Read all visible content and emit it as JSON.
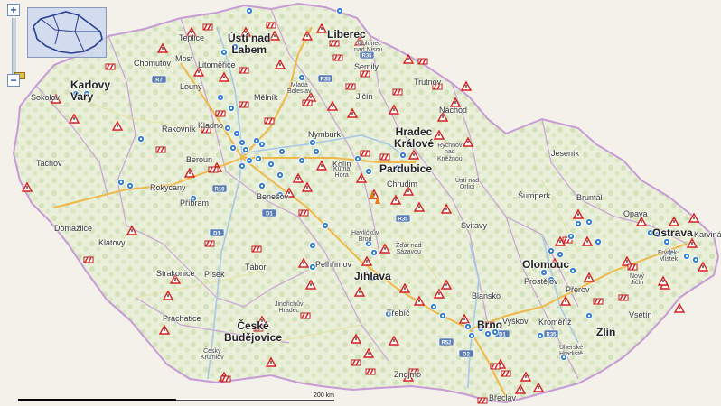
{
  "map": {
    "cities_big": [
      {
        "id": "karlovy-vary",
        "text": "Karlovy\nVary"
      },
      {
        "id": "usti",
        "text": "Ústí nad\nLabem"
      },
      {
        "id": "liberec",
        "text": "Liberec"
      },
      {
        "id": "hradec",
        "text": "Hradec\nKrálové"
      },
      {
        "id": "pardubice",
        "text": "Pardubice"
      },
      {
        "id": "jihlava",
        "text": "Jihlava"
      },
      {
        "id": "olomouc",
        "text": "Olomouc"
      },
      {
        "id": "ostrava",
        "text": "Ostrava"
      },
      {
        "id": "ceske",
        "text": "České\nBudějovice"
      },
      {
        "id": "brno",
        "text": "Brno"
      },
      {
        "id": "zlin",
        "text": "Zlín"
      }
    ],
    "cities_small": [
      {
        "id": "teplice",
        "text": "Teplice"
      },
      {
        "id": "chomutov",
        "text": "Chomutov"
      },
      {
        "id": "most",
        "text": "Most"
      },
      {
        "id": "litomerice",
        "text": "Litoměřice"
      },
      {
        "id": "jablonec",
        "text": "Jablonec\nnad Nisou"
      },
      {
        "id": "semily",
        "text": "Semily"
      },
      {
        "id": "trutnov",
        "text": "Trutnov"
      },
      {
        "id": "nachod",
        "text": "Náchod"
      },
      {
        "id": "sokolov",
        "text": "Sokolov"
      },
      {
        "id": "louny",
        "text": "Louny"
      },
      {
        "id": "melnik",
        "text": "Mělník"
      },
      {
        "id": "boleslav",
        "text": "Mladá\nBoleslav"
      },
      {
        "id": "jicin",
        "text": "Jičín"
      },
      {
        "id": "rakovnik",
        "text": "Rakovník"
      },
      {
        "id": "kladno",
        "text": "Kladno"
      },
      {
        "id": "nymburk",
        "text": "Nymburk"
      },
      {
        "id": "rychnov",
        "text": "Rychnov\nnad\nKněžnou"
      },
      {
        "id": "tachov",
        "text": "Tachov"
      },
      {
        "id": "beroun",
        "text": "Beroun"
      },
      {
        "id": "kolin",
        "text": "Kolín"
      },
      {
        "id": "kutna",
        "text": "Kutná\nHora"
      },
      {
        "id": "chrudim",
        "text": "Chrudim"
      },
      {
        "id": "usti-orlici",
        "text": "Ústí nad\nOrlicí"
      },
      {
        "id": "jesenik",
        "text": "Jeseník"
      },
      {
        "id": "rokycany",
        "text": "Rokycany"
      },
      {
        "id": "benesov",
        "text": "Benešov"
      },
      {
        "id": "sumperk",
        "text": "Šumperk"
      },
      {
        "id": "bruntal",
        "text": "Bruntál"
      },
      {
        "id": "pribram",
        "text": "Příbram"
      },
      {
        "id": "domazlice",
        "text": "Domažlice"
      },
      {
        "id": "svitavy",
        "text": "Svitavy"
      },
      {
        "id": "havlickuv",
        "text": "Havlíčkův\nBrod"
      },
      {
        "id": "opava",
        "text": "Opava"
      },
      {
        "id": "karvina",
        "text": "Karviná"
      },
      {
        "id": "klatovy",
        "text": "Klatovy"
      },
      {
        "id": "zdar",
        "text": "Žďár nad\nSázavou"
      },
      {
        "id": "frydek",
        "text": "Frýdek-\nMístek"
      },
      {
        "id": "pelhrimov",
        "text": "Pelhřimov"
      },
      {
        "id": "tabor",
        "text": "Tábor"
      },
      {
        "id": "strakonice",
        "text": "Strakonice"
      },
      {
        "id": "pisek",
        "text": "Písek"
      },
      {
        "id": "prostejov",
        "text": "Prostějov"
      },
      {
        "id": "prerov",
        "text": "Přerov"
      },
      {
        "id": "novy-jicin",
        "text": "Nový\nJičín"
      },
      {
        "id": "blansko",
        "text": "Blansko"
      },
      {
        "id": "trebic",
        "text": "Třebíč"
      },
      {
        "id": "jindrichuv",
        "text": "Jindřichův\nHradec"
      },
      {
        "id": "prachatice",
        "text": "Prachatice"
      },
      {
        "id": "vyskov",
        "text": "Vyškov"
      },
      {
        "id": "kromeriz",
        "text": "Kroměříž"
      },
      {
        "id": "vsetin",
        "text": "Vsetín"
      },
      {
        "id": "uherske",
        "text": "Uherské\nHradiště"
      },
      {
        "id": "krumlov",
        "text": "Český\nKrumlov"
      },
      {
        "id": "znojmo",
        "text": "Znojmo"
      },
      {
        "id": "breclav",
        "text": "Břeclav"
      }
    ],
    "road_shields": [
      "R7",
      "R10",
      "R35",
      "R35",
      "D1",
      "D1",
      "R35",
      "R52",
      "D2",
      "D1",
      "R35"
    ],
    "scale_label": "200 km",
    "zoom_in": "+",
    "zoom_out": "−"
  }
}
